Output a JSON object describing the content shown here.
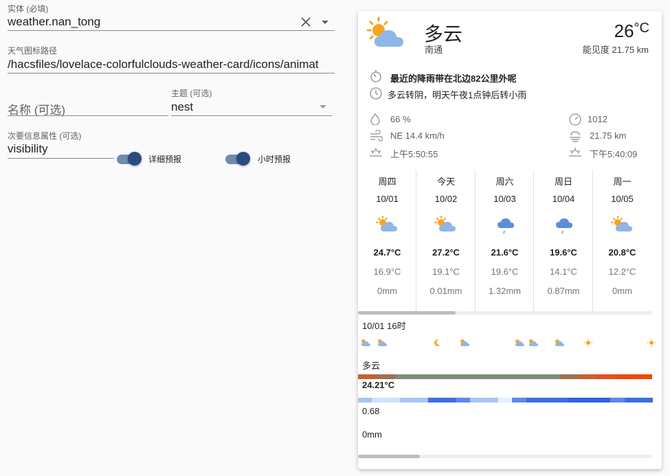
{
  "editor": {
    "entity": {
      "label": "实体 (必填)",
      "value": "weather.nan_tong"
    },
    "icon_path": {
      "label": "天气图标路径",
      "value": "/hacsfiles/lovelace-colorfulclouds-weather-card/icons/animat"
    },
    "name": {
      "placeholder": "名称 (可选)"
    },
    "theme": {
      "label": "主题 (可选)",
      "value": "nest"
    },
    "secondary_attr": {
      "label": "次要信息属性 (可选)",
      "value": "visibility"
    },
    "toggle_detail": {
      "label": "详细预报",
      "on": true
    },
    "toggle_hourly": {
      "label": "小时预报",
      "on": true
    }
  },
  "card": {
    "condition": "多云",
    "location": "南通",
    "temperature": "26",
    "temp_unit": "°C",
    "visibility_label": "能见度",
    "visibility_value": "21.75 km",
    "alert": "最近的降雨带在北边82公里外呢",
    "forecast_text": "多云转阴，明天午夜1点钟后转小雨",
    "humidity": "66 %",
    "wind": "NE 14.4 km/h",
    "sunrise": "上午5:50:55",
    "pressure": "1012",
    "visibility": "21.75 km",
    "sunset": "下午5:40:09",
    "daily": [
      {
        "day": "周四",
        "date": "10/01",
        "icon": "partly-cloudy-icon",
        "high": "24.7°C",
        "low": "16.9°C",
        "precip": "0mm"
      },
      {
        "day": "今天",
        "date": "10/02",
        "icon": "partly-cloudy-icon",
        "high": "27.2°C",
        "low": "19.1°C",
        "precip": "0.01mm"
      },
      {
        "day": "周六",
        "date": "10/03",
        "icon": "light-rain-icon",
        "high": "21.6°C",
        "low": "19.6°C",
        "precip": "1.32mm"
      },
      {
        "day": "周日",
        "date": "10/04",
        "icon": "light-rain-icon",
        "high": "19.6°C",
        "low": "14.1°C",
        "precip": "0.87mm"
      },
      {
        "day": "周一",
        "date": "10/05",
        "icon": "partly-cloudy-icon",
        "high": "20.8°C",
        "low": "12.2°C",
        "precip": "0mm"
      }
    ],
    "hourly": {
      "time": "10/01 16时",
      "condition": "多云",
      "temperature": "24.21°C",
      "value": "0.68",
      "precip": "0mm"
    },
    "colors": {
      "accent_toggle": "#2b4a80",
      "sun": "#f5a623",
      "cloud": "#8fb6e8"
    }
  }
}
